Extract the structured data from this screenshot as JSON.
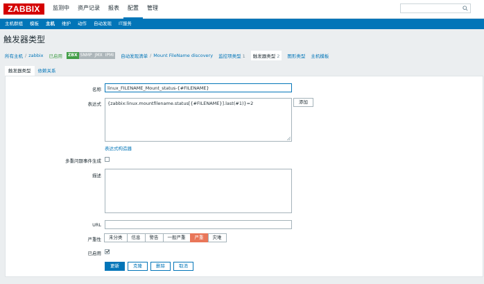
{
  "logo": "ZABBIX",
  "top_menu": [
    "监测中",
    "资产记录",
    "报表",
    "配置",
    "管理"
  ],
  "sub_menu": [
    "主机群组",
    "模板",
    "主机",
    "维护",
    "动作",
    "自动发现",
    "IT服务"
  ],
  "page_title": "触发器类型",
  "breadcrumb": {
    "all_hosts": "所有主机",
    "separator": "/",
    "host": "zabbix",
    "status": "已启用",
    "badges": [
      "ZBX",
      "SNMP",
      "JMX",
      "IPMI"
    ],
    "discovery_list": "自动发现清单",
    "discovery_rule": "Mount FileName discovery",
    "item_proto": "监控项类型",
    "item_proto_count": "1",
    "trigger_proto": "触发器类型",
    "trigger_proto_count": "2",
    "graph_proto": "图形类型",
    "host_proto": "主机模板"
  },
  "tabs": [
    "触发器类型",
    "依赖关系"
  ],
  "form": {
    "name_label": "名称",
    "name_value": "linux_FILENAME_Mount_status-{#FILENAME}",
    "expr_label": "表达式",
    "expr_value": "{zabbix:linux.mountfilename.status[{#FILENAME}].last(#1)}=2",
    "add_button": "添加",
    "expr_builder": "表达式构造器",
    "multi_label": "多重问题事件生成",
    "desc_label": "描述",
    "desc_value": "",
    "url_label": "URL",
    "url_value": "",
    "severity_label": "严重性",
    "severity_options": [
      "未分类",
      "信息",
      "警告",
      "一般严重",
      "严重",
      "灾难"
    ],
    "severity_selected": "严重",
    "enabled_label": "已启用",
    "enabled": true,
    "buttons": {
      "update": "更新",
      "clone": "克隆",
      "delete": "删除",
      "cancel": "取消"
    }
  },
  "colors": {
    "brand": "#d40000",
    "accent": "#0275b8",
    "severity_high": "#e97659",
    "enabled": "#429e47"
  }
}
